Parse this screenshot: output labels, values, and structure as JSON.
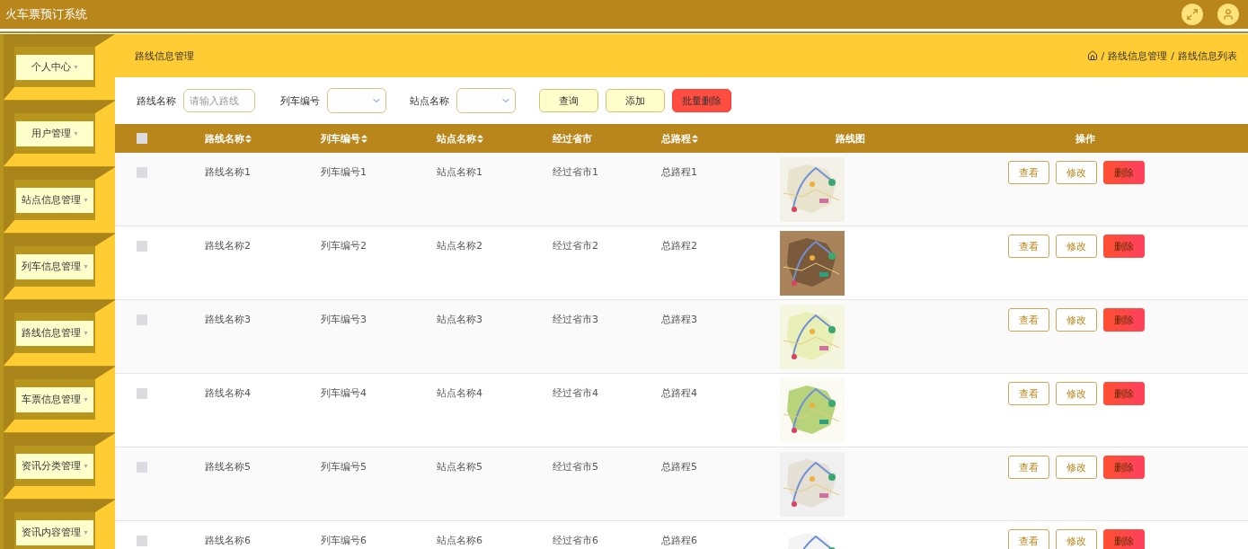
{
  "app": {
    "title": "火车票预订系统"
  },
  "sidebar": {
    "items": [
      {
        "label": "个人中心",
        "caret": "▾"
      },
      {
        "label": "用户管理",
        "caret": "▾"
      },
      {
        "label": "站点信息管理",
        "caret": "▾"
      },
      {
        "label": "列车信息管理",
        "caret": "▾"
      },
      {
        "label": "路线信息管理",
        "caret": "▾"
      },
      {
        "label": "车票信息管理",
        "caret": "▾"
      },
      {
        "label": "资讯分类管理",
        "caret": "▾"
      },
      {
        "label": "资讯内容管理",
        "caret": "▾"
      }
    ]
  },
  "page_header": {
    "title": "路线信息管理",
    "breadcrumb": [
      {
        "separator": "/",
        "label": "路线信息管理"
      },
      {
        "separator": "/",
        "label": "路线信息列表"
      }
    ]
  },
  "filters": {
    "fields": [
      {
        "kind": "input",
        "label": "路线名称",
        "placeholder": "请输入路线"
      },
      {
        "kind": "select",
        "label": "列车编号"
      },
      {
        "kind": "select",
        "label": "站点名称"
      }
    ],
    "buttons": [
      {
        "kind": "plain",
        "label": "查询"
      },
      {
        "kind": "plain",
        "label": "添加"
      },
      {
        "kind": "danger",
        "label": "批量删除"
      }
    ]
  },
  "table": {
    "select_all": {
      "checked": false
    },
    "columns": [
      "路线名称",
      "列车编号",
      "站点名称",
      "经过省市",
      "总路程",
      "路线图",
      "操作"
    ],
    "sortable": [
      true,
      true,
      true,
      false,
      true,
      false,
      false
    ],
    "rows": [
      {
        "checked": false,
        "cells": [
          "路线名称1",
          "列车编号1",
          "站点名称1",
          "经过省市1",
          "总路程1"
        ],
        "image": {
          "kind": "picture"
        },
        "actions": [
          "查看",
          "修改",
          "删除"
        ]
      },
      {
        "checked": false,
        "cells": [
          "路线名称2",
          "列车编号2",
          "站点名称2",
          "经过省市2",
          "总路程2"
        ],
        "image": {
          "kind": "picture"
        },
        "actions": [
          "查看",
          "修改",
          "删除"
        ]
      },
      {
        "checked": false,
        "cells": [
          "路线名称3",
          "列车编号3",
          "站点名称3",
          "经过省市3",
          "总路程3"
        ],
        "image": {
          "kind": "picture"
        },
        "actions": [
          "查看",
          "修改",
          "删除"
        ]
      },
      {
        "checked": false,
        "cells": [
          "路线名称4",
          "列车编号4",
          "站点名称4",
          "经过省市4",
          "总路程4"
        ],
        "image": {
          "kind": "picture"
        },
        "actions": [
          "查看",
          "修改",
          "删除"
        ]
      },
      {
        "checked": false,
        "cells": [
          "路线名称5",
          "列车编号5",
          "站点名称5",
          "经过省市5",
          "总路程5"
        ],
        "image": {
          "kind": "picture"
        },
        "actions": [
          "查看",
          "修改",
          "删除"
        ]
      },
      {
        "checked": false,
        "cells": [
          "路线名称6",
          "列车编号6",
          "站点名称6",
          "经过省市6",
          "总路程6"
        ],
        "image": {
          "kind": "picture"
        },
        "actions": [
          "查看",
          "修改",
          "删除"
        ]
      }
    ]
  }
}
